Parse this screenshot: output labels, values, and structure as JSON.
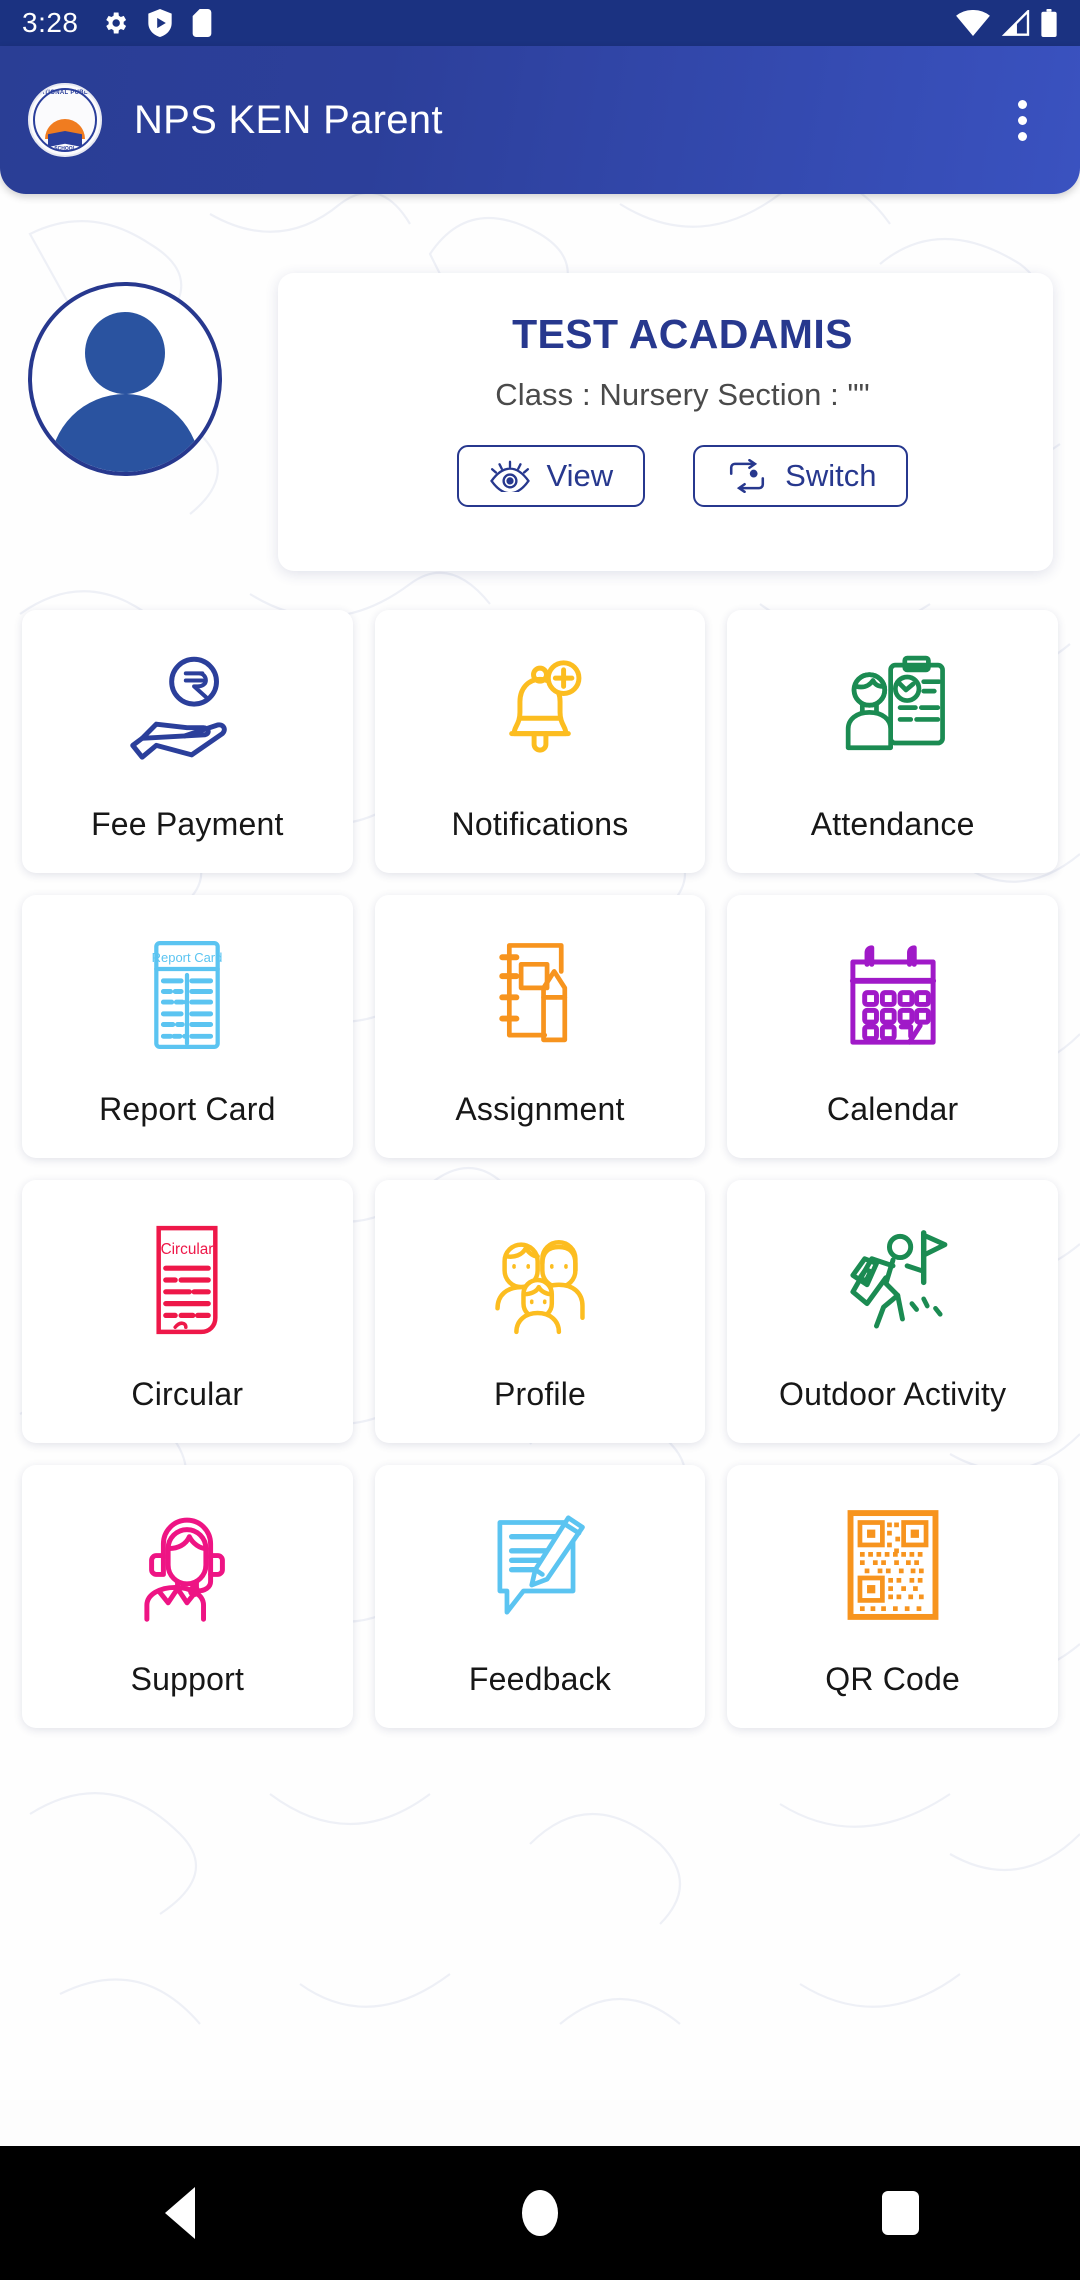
{
  "status_bar": {
    "time": "3:28",
    "left_icons": [
      "settings-gear-icon",
      "play-shield-icon",
      "sd-card-icon"
    ],
    "right_icons": [
      "wifi-icon",
      "cellular-signal-icon",
      "battery-icon"
    ]
  },
  "app_bar": {
    "title": "NPS KEN Parent",
    "logo_text_top": "NATIONAL PUBLIC",
    "logo_text_bottom": "SCHOOL",
    "overflow_menu": "more-options"
  },
  "student_card": {
    "name": "TEST ACADAMIS",
    "meta": "Class : Nursery   Section : \"\"",
    "view_button": "View",
    "switch_button": "Switch"
  },
  "menu": {
    "tiles": [
      {
        "label": "Fee Payment",
        "icon": "rupee-hand-icon",
        "color": "#2b3f9b"
      },
      {
        "label": "Notifications",
        "icon": "bell-plus-icon",
        "color": "#fcbd20"
      },
      {
        "label": "Attendance",
        "icon": "person-checklist-icon",
        "color": "#1b8b52"
      },
      {
        "label": "Report Card",
        "icon": "report-card-icon",
        "color": "#5bc4f1"
      },
      {
        "label": "Assignment",
        "icon": "notebook-pencil-icon",
        "color": "#f7941e"
      },
      {
        "label": "Calendar",
        "icon": "calendar-icon",
        "color": "#a019c8"
      },
      {
        "label": "Circular",
        "icon": "circular-doc-icon",
        "color": "#ee1849"
      },
      {
        "label": "Profile",
        "icon": "family-group-icon",
        "color": "#fcbd20"
      },
      {
        "label": "Outdoor Activity",
        "icon": "hiker-flag-icon",
        "color": "#1b8b52"
      },
      {
        "label": "Support",
        "icon": "headset-person-icon",
        "color": "#ee1484"
      },
      {
        "label": "Feedback",
        "icon": "feedback-pen-icon",
        "color": "#5bc4f1"
      },
      {
        "label": "QR Code",
        "icon": "qr-code-icon",
        "color": "#f7941e"
      }
    ]
  },
  "nav_bar": {
    "back": "back-button",
    "home": "home-button",
    "recents": "recents-button"
  },
  "colors": {
    "status_bar": "#1b3281",
    "app_bar_start": "#2a3e95",
    "app_bar_end": "#3a52c0",
    "brand_navy": "#27388e",
    "nav_bar": "#000000"
  }
}
